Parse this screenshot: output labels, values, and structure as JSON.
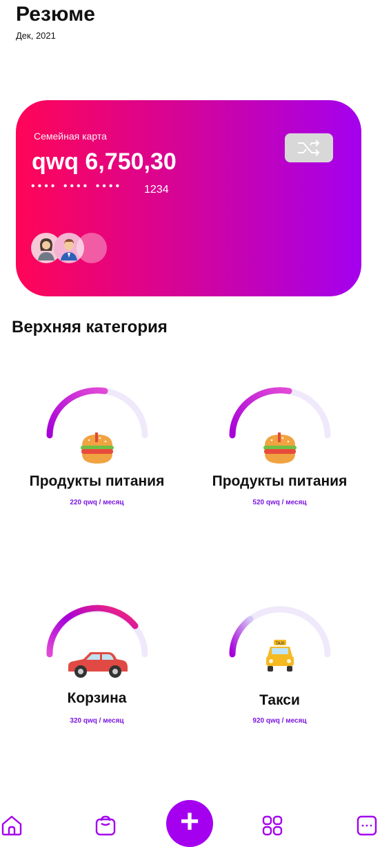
{
  "header": {
    "title": "Резюме",
    "date": "Дек, 2021"
  },
  "card": {
    "name": "Семейная карта",
    "balance": "qwq 6,750,30",
    "masked": "•••• •••• ••••",
    "last4": "1234",
    "gradient": [
      "#ff0557",
      "#a400ef"
    ]
  },
  "section": {
    "title": "Верхняя категория"
  },
  "categories": [
    {
      "name": "Продукты питания",
      "amount": "220 qwq / месяц",
      "icon": "burger-icon",
      "progress": 0.45
    },
    {
      "name": "Продукты питания",
      "amount": "520 qwq / месяц",
      "icon": "burger-icon",
      "progress": 0.5
    },
    {
      "name": "Корзина",
      "amount": "320 qwq / месяц",
      "icon": "car-icon",
      "progress": 0.8
    },
    {
      "name": "Такси",
      "amount": "920 qwq / месяц",
      "icon": "taxi-icon",
      "progress": 0.15
    }
  ],
  "nav": {
    "items": [
      "home-icon",
      "bag-icon",
      "add-icon",
      "grid-icon",
      "more-icon"
    ],
    "add_label": "+",
    "accent": "#a400ef"
  }
}
